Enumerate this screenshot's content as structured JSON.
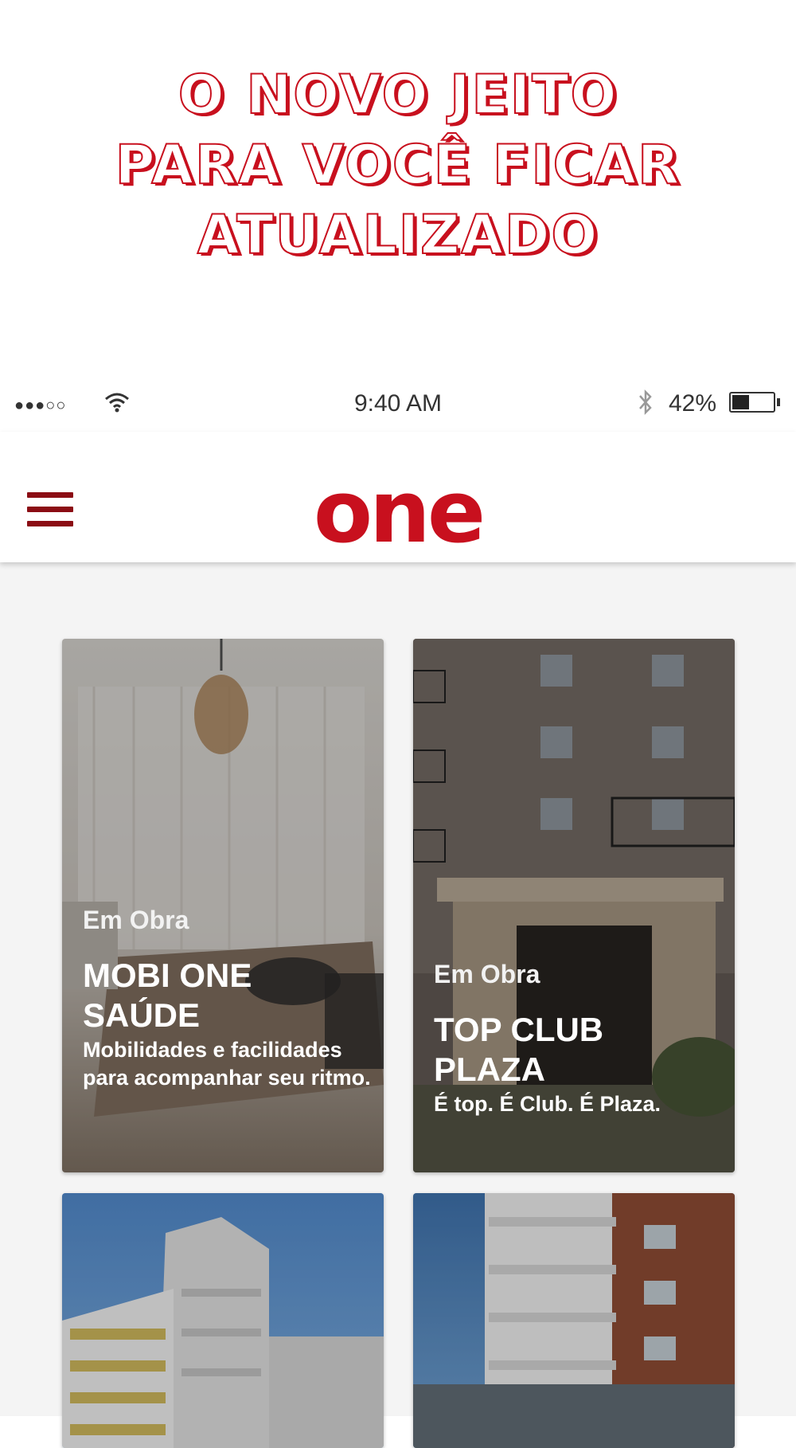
{
  "promo": {
    "line1": "O NOVO JEITO",
    "line2": "PARA VOCÊ FICAR",
    "line3": "ATUALIZADO"
  },
  "status_bar": {
    "signal": "●●●○○",
    "time": "9:40 AM",
    "battery_percent": "42%",
    "battery_level": 0.42
  },
  "header": {
    "logo_text": "one"
  },
  "colors": {
    "brand_red": "#c8101e",
    "dark_red": "#8b0d14",
    "background": "#f4f4f4"
  },
  "cards": [
    {
      "status": "Em Obra",
      "name_line1": "MOBI ONE",
      "name_line2": "SAÚDE",
      "slogan": "Mobilidades e facilidades para acompanhar seu ritmo."
    },
    {
      "status": "Em Obra",
      "name_line1": "TOP CLUB",
      "name_line2": "PLAZA",
      "slogan": "É top. É Club. É Plaza."
    },
    {
      "status": "",
      "name_line1": "",
      "name_line2": "",
      "slogan": ""
    },
    {
      "status": "",
      "name_line1": "",
      "name_line2": "",
      "slogan": ""
    }
  ]
}
